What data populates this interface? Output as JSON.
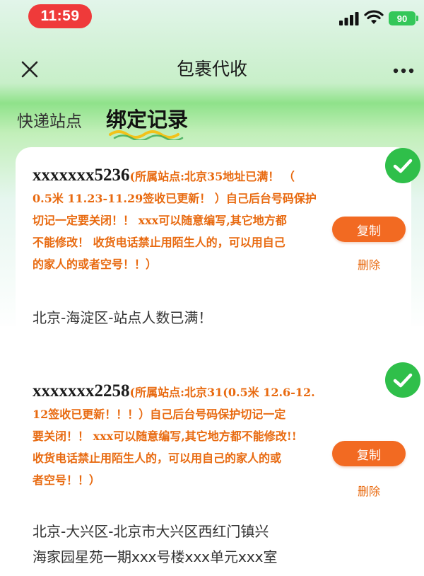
{
  "status_bar": {
    "time": "11:59",
    "battery": "90"
  },
  "nav": {
    "title": "包裹代收",
    "close_icon": "close-icon",
    "more_icon": "more-icon"
  },
  "tabs": [
    {
      "label": "快递站点",
      "active": false
    },
    {
      "label": "绑定记录",
      "active": true
    }
  ],
  "records": [
    {
      "code": "xxxxxxx5236",
      "note_lines": [
        "(所属站点:北京35地址已满！ （",
        "0.5米 11.23-11.29签收已更新！ ）自己后台号码保护",
        "切记一定要关闭！！ xxx可以随意编写,其它地方都",
        "不能修改！ 收货电话禁止用陌生人的，可以用自己",
        "的家人的或者空号！！）"
      ],
      "address": "北京-海淀区-站点人数已满！",
      "copy_label": "复制",
      "delete_label": "删除"
    },
    {
      "code": "xxxxxxx2258",
      "note_lines": [
        "(所属站点:北京31(0.5米 12.6-12.",
        "12签收已更新！！！）自己后台号码保护切记一定",
        "要关闭！！ xxx可以随意编写,其它地方都不能修改!!",
        "收货电话禁止用陌生人的，可以用自己的家人的或",
        "者空号！！）"
      ],
      "address_lines": [
        "北京-大兴区-北京市大兴区西红门镇兴",
        "海家园星苑一期xxx号楼xxx单元xxx室"
      ],
      "copy_label": "复制",
      "delete_label": "删除"
    }
  ],
  "colors": {
    "accent_orange": "#f26a22",
    "note_orange": "#e86a10",
    "check_green": "#2fbf4a",
    "time_red": "#ef3a3a"
  }
}
